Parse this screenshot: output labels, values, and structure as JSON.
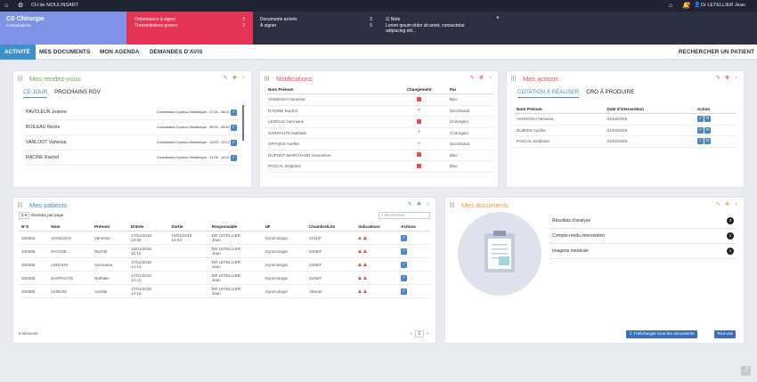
{
  "topbar": {
    "site": "CH de MOULINSART",
    "notif_count": "1",
    "user": "Dr LETELLIER Jean"
  },
  "header": {
    "service_title": "CS Chirurgie",
    "service_sub": "Consultations",
    "ord_label": "Ordonnance à signer",
    "ord_count": "2",
    "trans_label": "Transmissions graves",
    "trans_count": "2",
    "docs_label": "Documents arrivés",
    "docs_count": "2",
    "sign_label": "À signer",
    "sign_count": "5",
    "note_title": "Note",
    "note_text": "Lorem ipsum dolor sit amet, consectetur adipiscing elit..."
  },
  "nav": {
    "items": [
      "ACTIVITÉ",
      "MES DOCUMENTS",
      "MON AGENDA",
      "DEMANDES D'AVIS"
    ],
    "search": "RECHERCHER UN PATIENT"
  },
  "rdv": {
    "title": "Mes rendez-vous",
    "tabs": [
      "CE JOUR",
      "PROCHAINS RDV"
    ],
    "rows": [
      {
        "name": "PAVOLEUN Joanne",
        "info": "Consultation Gynéco-Obstétrique - 07:45 - 08:02"
      },
      {
        "name": "BOILEAU Nicole",
        "info": "Consultation Gynéco-Obstétrique - 08:30 - 08:45"
      },
      {
        "name": "VANLOOT Vanessa",
        "info": "Consultation Gynéco-Obstétrique - 13:00 - 13:22"
      },
      {
        "name": "RACINE Rachel",
        "info": "Consultation Gynéco-Obstétrique - 14:05 - 14:22"
      }
    ]
  },
  "notifs": {
    "title": "Notifications",
    "cols": [
      "Nom Prénom",
      "Changement",
      "Par"
    ],
    "rows": [
      {
        "name": "VANSOGH Vanessa",
        "change": "doc",
        "par": "Bloc"
      },
      {
        "name": "RACINE Rachel",
        "change": "x",
        "par": "Secrétariat"
      },
      {
        "name": "LEDOUX Germaine",
        "change": "doc",
        "par": "Chirurgien"
      },
      {
        "name": "SARRAUTE Nathalie",
        "change": "plus",
        "par": "Chirurgien"
      },
      {
        "name": "ORTHOS Aurélie",
        "change": "plus",
        "par": "Secrétariat"
      },
      {
        "name": "DUPONT-MARCHAND Geneviève",
        "change": "doc",
        "par": "Bloc"
      },
      {
        "name": "PASCAL Delphine",
        "change": "doc",
        "par": "Bloc"
      }
    ]
  },
  "actions": {
    "title": "Mes actions",
    "tabs": [
      "COTATION À RÉALISER",
      "CRO À PRODUIRE"
    ],
    "cols": [
      "Nom Prénom",
      "Date d'intervention",
      "Action"
    ],
    "rows": [
      {
        "name": "VANSOGH Vanessa",
        "date": "01/02/2018"
      },
      {
        "name": "DUBOIS Aurélie",
        "date": "01/02/2018"
      },
      {
        "name": "PASCAL Delphine",
        "date": "01/02/2018"
      }
    ]
  },
  "patients": {
    "title": "Mes patients",
    "page_size": "5",
    "page_size_label": "résultats par page",
    "search_placeholder": "Rechercher",
    "cols": [
      "N°S",
      "Nom",
      "Prénom",
      "Entrée",
      "Sortie",
      "Responsable",
      "UF",
      "Chambre/Lits",
      "Indicateurs",
      "Actions"
    ],
    "rows": [
      {
        "ns": "330384",
        "nom": "VANSOGH",
        "prenom": "Vanessa",
        "entree": "17/01/2018",
        "entree_h": "13:34",
        "sortie": "13/01/2018",
        "sortie_h": "13:34",
        "resp": "DR LETELLIER",
        "resp2": "Jean",
        "uf": "Gynécologie",
        "ch": "2411/F"
      },
      {
        "ns": "330385",
        "nom": "RACINE",
        "prenom": "Rachel",
        "entree": "13/01/2018",
        "entree_h": "10:12",
        "sortie": "",
        "sortie_h": "",
        "resp": "DR LETELLIER",
        "resp2": "Jean",
        "uf": "Gynécologie",
        "ch": "2406/F"
      },
      {
        "ns": "330385",
        "nom": "LEDOUX",
        "prenom": "Germaine",
        "entree": "17/01/2018",
        "entree_h": "14:12",
        "sortie": "",
        "sortie_h": "",
        "resp": "DR LETELLIER",
        "resp2": "Jean",
        "uf": "Gynécologie",
        "ch": "2406/F"
      },
      {
        "ns": "330385",
        "nom": "SARRAUTE",
        "prenom": "Nathalie",
        "entree": "17/01/2018",
        "entree_h": "14:12",
        "sortie": "",
        "sortie_h": "",
        "resp": "DR LETELLIER",
        "resp2": "Jean",
        "uf": "Gynécologie",
        "ch": "2106/F"
      },
      {
        "ns": "330385",
        "nom": "DUBOIS",
        "prenom": "Aurélie",
        "entree": "17/01/2018",
        "entree_h": "14:12",
        "sortie": "",
        "sortie_h": "",
        "resp": "DR LETELLIER",
        "resp2": "Jean",
        "uf": "Gynécologie",
        "ch": "Attente"
      }
    ],
    "footer": "5 éléments",
    "page": "1"
  },
  "docs": {
    "title": "Mes documents",
    "items": [
      {
        "label": "Résultats d'analyse",
        "count": "3"
      },
      {
        "label": "Compte-rendu intervention",
        "count": "1"
      },
      {
        "label": "Imagerie médicale",
        "count": "1"
      }
    ],
    "download_btn": "Télécharger tous les documents",
    "all_btn": "Tout voir"
  },
  "colors": {
    "accent": "#3c8fc8",
    "danger": "#e63353",
    "header_blue": "#7e93e6",
    "dark": "#1f2332"
  }
}
